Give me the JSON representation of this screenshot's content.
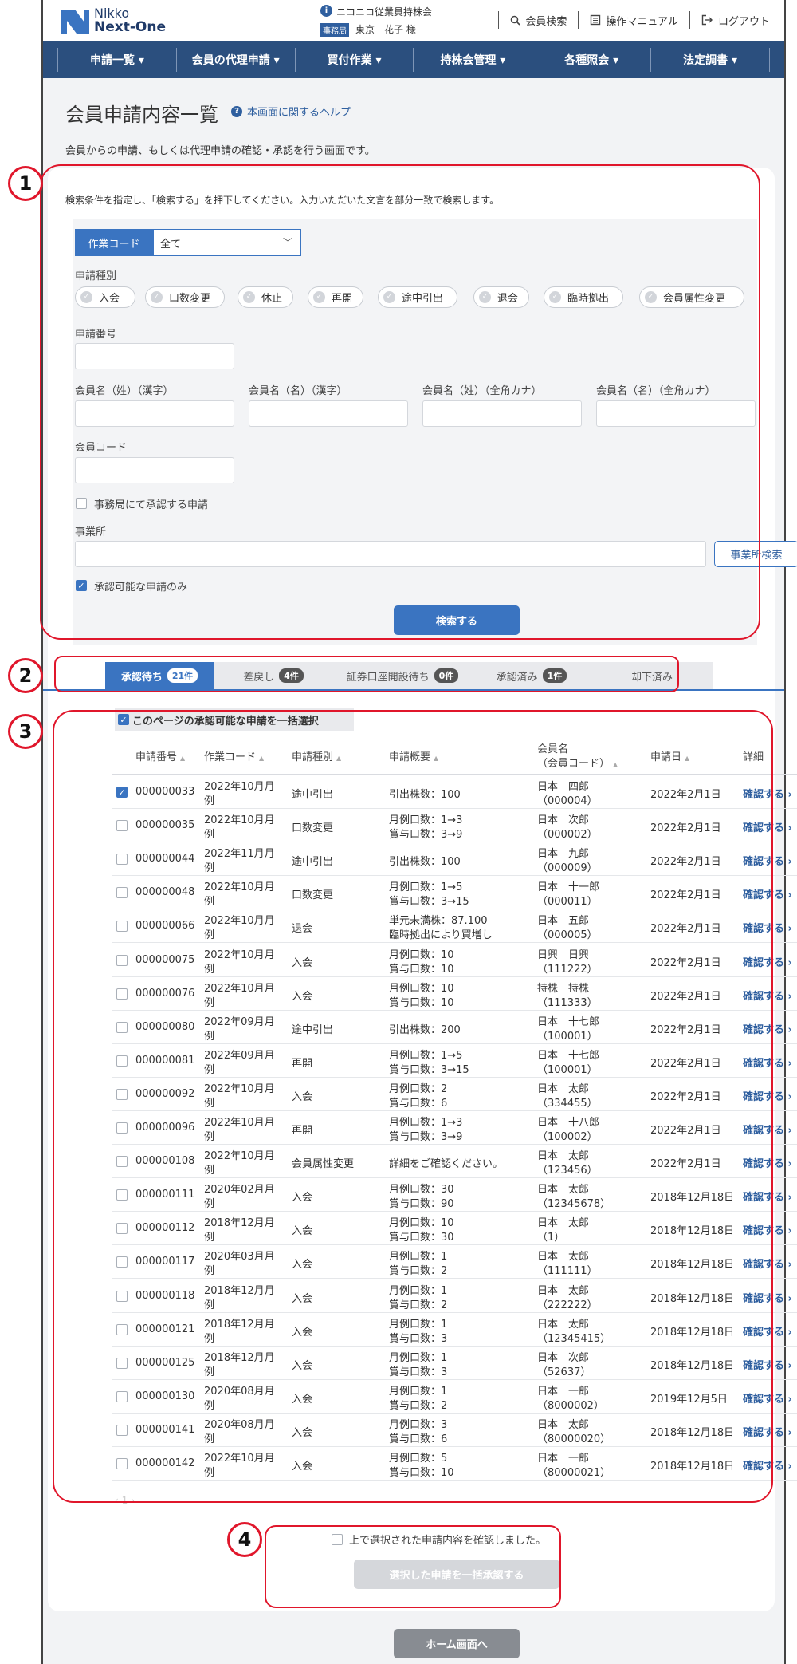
{
  "header": {
    "logo_line1": "Nikko",
    "logo_line2": "Next-One",
    "company": "ニコニコ従業員持株会",
    "role_badge": "事務局",
    "user_name": "東京　花子 様",
    "links": [
      {
        "label": "会員検索",
        "icon": "search-icon"
      },
      {
        "label": "操作マニュアル",
        "icon": "manual-icon"
      },
      {
        "label": "ログアウト",
        "icon": "logout-icon"
      }
    ]
  },
  "nav": [
    "申請一覧 ▾",
    "会員の代理申請 ▾",
    "買付作業 ▾",
    "持株会管理 ▾",
    "各種照会 ▾",
    "法定調書 ▾"
  ],
  "page": {
    "title": "会員申請内容一覧",
    "help_link": "本画面に関するヘルプ",
    "description": "会員からの申請、もしくは代理申請の確認・承認を行う画面です。"
  },
  "search": {
    "description": "検索条件を指定し、「検索する」を押下してください。入力いただいた文言を部分一致で検索します。",
    "work_code_label": "作業コード",
    "work_code_value": "全て",
    "type_label": "申請種別",
    "types": [
      "入会",
      "口数変更",
      "休止",
      "再開",
      "途中引出",
      "退会",
      "臨時拠出",
      "会員属性変更"
    ],
    "app_number_label": "申請番号",
    "name_labels": [
      "会員名（姓）（漢字）",
      "会員名（名）（漢字）",
      "会員名（姓）（全角カナ）",
      "会員名（名）（全角カナ）"
    ],
    "member_code_label": "会員コード",
    "office_approve_label": "事務局にて承認する申請",
    "office_label": "事業所",
    "office_search_button": "事業所検索",
    "approvable_only_label": "承認可能な申請のみ",
    "search_button": "検索する"
  },
  "tabs": [
    {
      "label": "承認待ち",
      "count": "21件"
    },
    {
      "label": "差戻し",
      "count": "4件"
    },
    {
      "label": "証券口座開設待ち",
      "count": "0件"
    },
    {
      "label": "承認済み",
      "count": "1件"
    },
    {
      "label": "却下済み",
      "count": ""
    }
  ],
  "bulk_select_label": "このページの承認可能な申請を一括選択",
  "table": {
    "headers": [
      "申請番号",
      "作業コード",
      "申請種別",
      "申請概要",
      "会員名",
      "（会員コード）",
      "申請日",
      "詳細"
    ],
    "rows": [
      {
        "checked": true,
        "no": "000000033",
        "code1": "2022年10月月",
        "code2": "例",
        "type": "途中引出",
        "sum1": "引出株数：100",
        "sum2": "",
        "name": "日本　四郎",
        "mcode": "（000004）",
        "date": "2022年2月1日",
        "link": "確認する ›"
      },
      {
        "checked": false,
        "no": "000000035",
        "code1": "2022年10月月",
        "code2": "例",
        "type": "口数変更",
        "sum1": "月例口数：1→3",
        "sum2": "賞与口数：3→9",
        "name": "日本　次郎",
        "mcode": "（000002）",
        "date": "2022年2月1日",
        "link": "確認する ›"
      },
      {
        "checked": false,
        "no": "000000044",
        "code1": "2022年11月月",
        "code2": "例",
        "type": "途中引出",
        "sum1": "引出株数：100",
        "sum2": "",
        "name": "日本　九郎",
        "mcode": "（000009）",
        "date": "2022年2月1日",
        "link": "確認する ›"
      },
      {
        "checked": false,
        "no": "000000048",
        "code1": "2022年10月月",
        "code2": "例",
        "type": "口数変更",
        "sum1": "月例口数：1→5",
        "sum2": "賞与口数：3→15",
        "name": "日本　十一郎",
        "mcode": "（000011）",
        "date": "2022年2月1日",
        "link": "確認する ›"
      },
      {
        "checked": false,
        "no": "000000066",
        "code1": "2022年10月月",
        "code2": "例",
        "type": "退会",
        "sum1": "単元未満株：87.100",
        "sum2": "臨時拠出により買増し",
        "name": "日本　五郎",
        "mcode": "（000005）",
        "date": "2022年2月1日",
        "link": "確認する ›"
      },
      {
        "checked": false,
        "no": "000000075",
        "code1": "2022年10月月",
        "code2": "例",
        "type": "入会",
        "sum1": "月例口数：10",
        "sum2": "賞与口数：10",
        "name": "日興　日興",
        "mcode": "（111222）",
        "date": "2022年2月1日",
        "link": "確認する ›"
      },
      {
        "checked": false,
        "no": "000000076",
        "code1": "2022年10月月",
        "code2": "例",
        "type": "入会",
        "sum1": "月例口数：10",
        "sum2": "賞与口数：10",
        "name": "持株　持株",
        "mcode": "（111333）",
        "date": "2022年2月1日",
        "link": "確認する ›"
      },
      {
        "checked": false,
        "no": "000000080",
        "code1": "2022年09月月",
        "code2": "例",
        "type": "途中引出",
        "sum1": "引出株数：200",
        "sum2": "",
        "name": "日本　十七郎",
        "mcode": "（100001）",
        "date": "2022年2月1日",
        "link": "確認する ›"
      },
      {
        "checked": false,
        "no": "000000081",
        "code1": "2022年09月月",
        "code2": "例",
        "type": "再開",
        "sum1": "月例口数：1→5",
        "sum2": "賞与口数：3→15",
        "name": "日本　十七郎",
        "mcode": "（100001）",
        "date": "2022年2月1日",
        "link": "確認する ›"
      },
      {
        "checked": false,
        "no": "000000092",
        "code1": "2022年10月月",
        "code2": "例",
        "type": "入会",
        "sum1": "月例口数：2",
        "sum2": "賞与口数：6",
        "name": "日本　太郎",
        "mcode": "（334455）",
        "date": "2022年2月1日",
        "link": "確認する ›"
      },
      {
        "checked": false,
        "no": "000000096",
        "code1": "2022年10月月",
        "code2": "例",
        "type": "再開",
        "sum1": "月例口数：1→3",
        "sum2": "賞与口数：3→9",
        "name": "日本　十八郎",
        "mcode": "（100002）",
        "date": "2022年2月1日",
        "link": "確認する ›"
      },
      {
        "checked": false,
        "no": "000000108",
        "code1": "2022年10月月",
        "code2": "例",
        "type": "会員属性変更",
        "sum1": "詳細をご確認ください。",
        "sum2": "",
        "name": "日本　太郎",
        "mcode": "（123456）",
        "date": "2022年2月1日",
        "link": "確認する ›"
      },
      {
        "checked": false,
        "no": "000000111",
        "code1": "2020年02月月",
        "code2": "例",
        "type": "入会",
        "sum1": "月例口数：30",
        "sum2": "賞与口数：90",
        "name": "日本　太郎",
        "mcode": "（12345678）",
        "date": "2018年12月18日",
        "link": "確認する ›"
      },
      {
        "checked": false,
        "no": "000000112",
        "code1": "2018年12月月",
        "code2": "例",
        "type": "入会",
        "sum1": "月例口数：10",
        "sum2": "賞与口数：30",
        "name": "日本　太郎",
        "mcode": "（1）",
        "date": "2018年12月18日",
        "link": "確認する ›"
      },
      {
        "checked": false,
        "no": "000000117",
        "code1": "2020年03月月",
        "code2": "例",
        "type": "入会",
        "sum1": "月例口数：1",
        "sum2": "賞与口数：2",
        "name": "日本　太郎",
        "mcode": "（111111）",
        "date": "2018年12月18日",
        "link": "確認する ›"
      },
      {
        "checked": false,
        "no": "000000118",
        "code1": "2018年12月月",
        "code2": "例",
        "type": "入会",
        "sum1": "月例口数：1",
        "sum2": "賞与口数：2",
        "name": "日本　太郎",
        "mcode": "（222222）",
        "date": "2018年12月18日",
        "link": "確認する ›"
      },
      {
        "checked": false,
        "no": "000000121",
        "code1": "2018年12月月",
        "code2": "例",
        "type": "入会",
        "sum1": "月例口数：1",
        "sum2": "賞与口数：3",
        "name": "日本　太郎",
        "mcode": "（12345415）",
        "date": "2018年12月18日",
        "link": "確認する ›"
      },
      {
        "checked": false,
        "no": "000000125",
        "code1": "2018年12月月",
        "code2": "例",
        "type": "入会",
        "sum1": "月例口数：1",
        "sum2": "賞与口数：3",
        "name": "日本　次郎",
        "mcode": "（52637）",
        "date": "2018年12月18日",
        "link": "確認する ›"
      },
      {
        "checked": false,
        "no": "000000130",
        "code1": "2020年08月月",
        "code2": "例",
        "type": "入会",
        "sum1": "月例口数：1",
        "sum2": "賞与口数：2",
        "name": "日本　一郎",
        "mcode": "（8000002）",
        "date": "2019年12月5日",
        "link": "確認する ›"
      },
      {
        "checked": false,
        "no": "000000141",
        "code1": "2020年08月月",
        "code2": "例",
        "type": "入会",
        "sum1": "月例口数：3",
        "sum2": "賞与口数：6",
        "name": "日本　太郎",
        "mcode": "（80000020）",
        "date": "2018年12月18日",
        "link": "確認する ›"
      },
      {
        "checked": false,
        "no": "000000142",
        "code1": "2022年10月月",
        "code2": "例",
        "type": "入会",
        "sum1": "月例口数：5",
        "sum2": "賞与口数：10",
        "name": "日本　一郎",
        "mcode": "（80000021）",
        "date": "2018年12月18日",
        "link": "確認する ›"
      }
    ]
  },
  "pager": "‹  1  ›",
  "confirm_label": "上で選択された申請内容を確認しました。",
  "approve_button": "選択した申請を一括承認する",
  "home_button": "ホーム画面へ",
  "annotations": [
    "1",
    "2",
    "3",
    "4"
  ],
  "colors": {
    "nav": "#2b4f7e",
    "accent": "#3a74c1",
    "annotation": "#e0162b"
  }
}
